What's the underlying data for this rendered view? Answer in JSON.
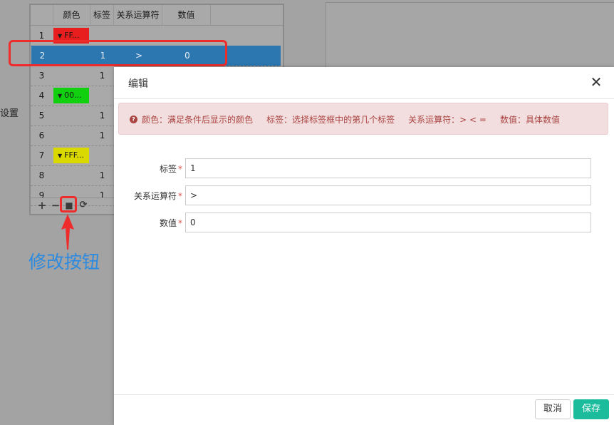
{
  "side_label": "设置",
  "grid": {
    "columns": [
      "颜色",
      "标签",
      "关系运算符",
      "数值"
    ],
    "rows": [
      {
        "num": "1",
        "color_text": "FF...",
        "color": "#e81e1e",
        "label": "",
        "op": "",
        "value": ""
      },
      {
        "num": "2",
        "color_text": "",
        "color": "",
        "label": "1",
        "op": ">",
        "value": "0"
      },
      {
        "num": "3",
        "color_text": "",
        "color": "",
        "label": "1",
        "op": "",
        "value": ""
      },
      {
        "num": "4",
        "color_text": "00...",
        "color": "#10d010",
        "label": "",
        "op": "",
        "value": ""
      },
      {
        "num": "5",
        "color_text": "",
        "color": "",
        "label": "1",
        "op": "",
        "value": ""
      },
      {
        "num": "6",
        "color_text": "",
        "color": "",
        "label": "1",
        "op": "",
        "value": ""
      },
      {
        "num": "7",
        "color_text": "FFF...",
        "color": "#d9d900",
        "label": "",
        "op": "",
        "value": ""
      },
      {
        "num": "8",
        "color_text": "",
        "color": "",
        "label": "1",
        "op": "",
        "value": ""
      },
      {
        "num": "9",
        "color_text": "",
        "color": "",
        "label": "1",
        "op": "",
        "value": ""
      }
    ],
    "toolbar": {
      "add": "+",
      "remove": "−",
      "edit": "■",
      "refresh": "⟳"
    }
  },
  "annotation": {
    "text": "修改按钮",
    "color": "#2c8be0"
  },
  "dialog": {
    "title": "编辑",
    "close": "✕",
    "alert": {
      "icon": "?",
      "text": "颜色：满足条件后显示的颜色     标签：选择标签框中的第几个标签     关系运算符：> < =     数值：具体数值"
    },
    "fields": [
      {
        "label": "标签",
        "required": "*",
        "value": "1"
      },
      {
        "label": "关系运算符",
        "required": "*",
        "value": ">"
      },
      {
        "label": "数值",
        "required": "*",
        "value": "0"
      }
    ],
    "buttons": {
      "cancel": "取消",
      "save": "保存"
    }
  }
}
